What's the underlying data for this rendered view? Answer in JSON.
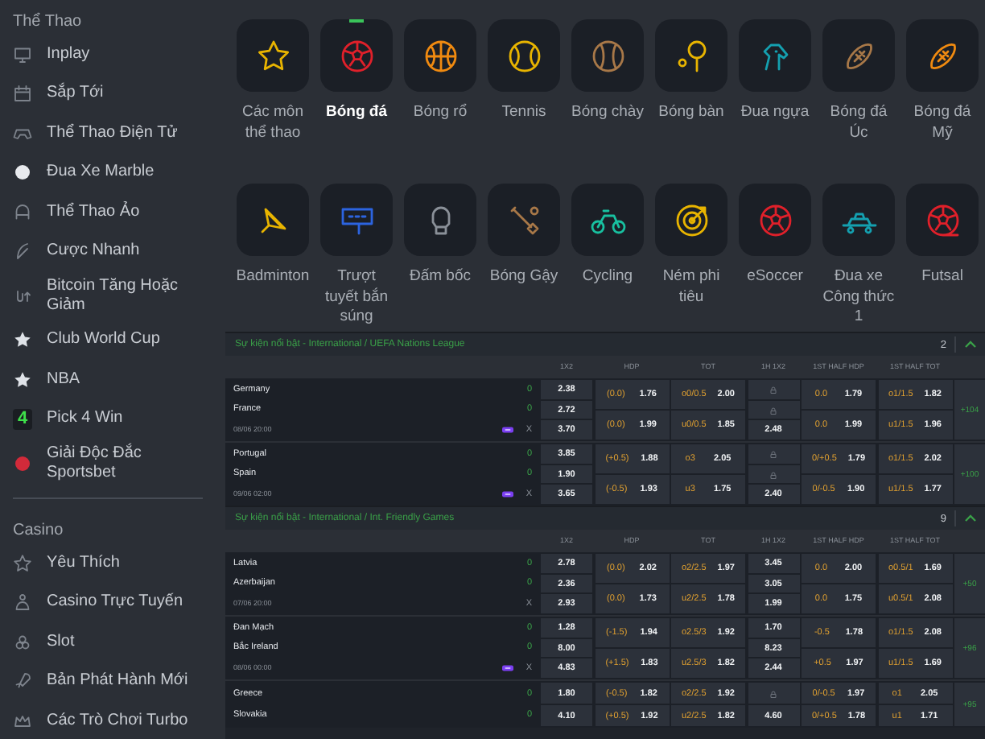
{
  "sidebar": {
    "sections": [
      {
        "heading": "Thể Thao",
        "items": [
          {
            "label": "Inplay"
          },
          {
            "label": "Sắp Tới"
          },
          {
            "label": "Thể Thao Điện Tử"
          },
          {
            "label": "Đua Xe Marble"
          },
          {
            "label": "Thể Thao Ảo"
          },
          {
            "label": "Cược Nhanh"
          },
          {
            "label": "Bitcoin Tăng Hoặc Giảm"
          },
          {
            "label": "Club World Cup"
          },
          {
            "label": "NBA"
          },
          {
            "label": "Pick 4 Win",
            "logo_text": "4"
          },
          {
            "label": "Giải Độc Đắc Sportsbet"
          }
        ]
      },
      {
        "heading": "Casino",
        "items": [
          {
            "label": "Yêu Thích"
          },
          {
            "label": "Casino Trực Tuyến"
          },
          {
            "label": "Slot"
          },
          {
            "label": "Bản Phát Hành Mới"
          },
          {
            "label": "Các Trò Chơi Turbo"
          }
        ]
      }
    ]
  },
  "sports": [
    {
      "label": "Các môn thể thao",
      "selected": false
    },
    {
      "label": "Bóng đá",
      "selected": true
    },
    {
      "label": "Bóng rổ",
      "selected": false
    },
    {
      "label": "Tennis",
      "selected": false
    },
    {
      "label": "Bóng chày",
      "selected": false
    },
    {
      "label": "Bóng bàn",
      "selected": false
    },
    {
      "label": "Đua ngựa",
      "selected": false
    },
    {
      "label": "Bóng đá Úc",
      "selected": false
    },
    {
      "label": "Bóng đá Mỹ",
      "selected": false
    },
    {
      "label": "Badminton",
      "selected": false
    },
    {
      "label": "Trượt tuyết bắn súng",
      "selected": false
    },
    {
      "label": "Đấm bốc",
      "selected": false
    },
    {
      "label": "Bóng Gậy",
      "selected": false
    },
    {
      "label": "Cycling",
      "selected": false
    },
    {
      "label": "Ném phi tiêu",
      "selected": false
    },
    {
      "label": "eSoccer",
      "selected": false
    },
    {
      "label": "Đua xe Công thức 1",
      "selected": false
    },
    {
      "label": "Futsal",
      "selected": false
    }
  ],
  "sections": [
    {
      "title": "Sự kiện nổi bật - International / UEFA Nations League",
      "count": "2",
      "expanded": true,
      "columns": [
        "1X2",
        "HDP",
        "TOT",
        "1H 1X2",
        "1ST HALF HDP",
        "1ST HALF TOT"
      ],
      "matches": [
        {
          "home": "Germany",
          "away": "France",
          "home_score": "0",
          "away_score": "0",
          "time": "08/06 20:00",
          "live": true,
          "draw": "X",
          "x12": [
            "2.38",
            "2.72",
            "3.70"
          ],
          "hdp": [
            {
              "line": "(0.0)",
              "odd": "1.76"
            },
            {
              "line": "(0.0)",
              "odd": "1.99"
            }
          ],
          "tot": [
            {
              "line": "o0/0.5",
              "odd": "2.00"
            },
            {
              "line": "u0/0.5",
              "odd": "1.85"
            }
          ],
          "h1_x12": [
            {
              "locked": true
            },
            {
              "locked": true
            },
            {
              "locked": false,
              "odd": "2.48"
            }
          ],
          "h1_hdp": [
            {
              "line": "0.0",
              "odd": "1.79"
            },
            {
              "line": "0.0",
              "odd": "1.99"
            }
          ],
          "h1_tot": [
            {
              "line": "o1/1.5",
              "odd": "1.82"
            },
            {
              "line": "u1/1.5",
              "odd": "1.96"
            }
          ],
          "more": "+104"
        },
        {
          "home": "Portugal",
          "away": "Spain",
          "home_score": "0",
          "away_score": "0",
          "time": "09/06 02:00",
          "live": true,
          "draw": "X",
          "x12": [
            "3.85",
            "1.90",
            "3.65"
          ],
          "hdp": [
            {
              "line": "(+0.5)",
              "odd": "1.88"
            },
            {
              "line": "(-0.5)",
              "odd": "1.93"
            }
          ],
          "tot": [
            {
              "line": "o3",
              "odd": "2.05"
            },
            {
              "line": "u3",
              "odd": "1.75"
            }
          ],
          "h1_x12": [
            {
              "locked": true
            },
            {
              "locked": true
            },
            {
              "locked": false,
              "odd": "2.40"
            }
          ],
          "h1_hdp": [
            {
              "line": "0/+0.5",
              "odd": "1.79"
            },
            {
              "line": "0/-0.5",
              "odd": "1.90"
            }
          ],
          "h1_tot": [
            {
              "line": "o1/1.5",
              "odd": "2.02"
            },
            {
              "line": "u1/1.5",
              "odd": "1.77"
            }
          ],
          "more": "+100"
        }
      ]
    },
    {
      "title": "Sự kiện nổi bật - International / Int. Friendly Games",
      "count": "9",
      "expanded": true,
      "columns": [
        "1X2",
        "HDP",
        "TOT",
        "1H 1X2",
        "1ST HALF HDP",
        "1ST HALF TOT"
      ],
      "matches": [
        {
          "home": "Latvia",
          "away": "Azerbaijan",
          "home_score": "0",
          "away_score": "0",
          "time": "07/06 20:00",
          "live": false,
          "draw": "X",
          "x12": [
            "2.78",
            "2.36",
            "2.93"
          ],
          "hdp": [
            {
              "line": "(0.0)",
              "odd": "2.02"
            },
            {
              "line": "(0.0)",
              "odd": "1.73"
            }
          ],
          "tot": [
            {
              "line": "o2/2.5",
              "odd": "1.97"
            },
            {
              "line": "u2/2.5",
              "odd": "1.78"
            }
          ],
          "h1_x12": [
            {
              "locked": false,
              "odd": "3.45"
            },
            {
              "locked": false,
              "odd": "3.05"
            },
            {
              "locked": false,
              "odd": "1.99"
            }
          ],
          "h1_hdp": [
            {
              "line": "0.0",
              "odd": "2.00"
            },
            {
              "line": "0.0",
              "odd": "1.75"
            }
          ],
          "h1_tot": [
            {
              "line": "o0.5/1",
              "odd": "1.69"
            },
            {
              "line": "u0.5/1",
              "odd": "2.08"
            }
          ],
          "more": "+50"
        },
        {
          "home": "Đan Mạch",
          "away": "Bắc Ireland",
          "home_score": "0",
          "away_score": "0",
          "time": "08/06 00:00",
          "live": true,
          "draw": "X",
          "x12": [
            "1.28",
            "8.00",
            "4.83"
          ],
          "hdp": [
            {
              "line": "(-1.5)",
              "odd": "1.94"
            },
            {
              "line": "(+1.5)",
              "odd": "1.83"
            }
          ],
          "tot": [
            {
              "line": "o2.5/3",
              "odd": "1.92"
            },
            {
              "line": "u2.5/3",
              "odd": "1.82"
            }
          ],
          "h1_x12": [
            {
              "locked": false,
              "odd": "1.70"
            },
            {
              "locked": false,
              "odd": "8.23"
            },
            {
              "locked": false,
              "odd": "2.44"
            }
          ],
          "h1_hdp": [
            {
              "line": "-0.5",
              "odd": "1.78"
            },
            {
              "line": "+0.5",
              "odd": "1.97"
            }
          ],
          "h1_tot": [
            {
              "line": "o1/1.5",
              "odd": "2.08"
            },
            {
              "line": "u1/1.5",
              "odd": "1.69"
            }
          ],
          "more": "+96"
        },
        {
          "home": "Greece",
          "away": "Slovakia",
          "home_score": "0",
          "away_score": "0",
          "x12": [
            "1.80",
            "4.10"
          ],
          "hdp": [
            {
              "line": "(-0.5)",
              "odd": "1.82"
            },
            {
              "line": "(+0.5)",
              "odd": "1.92"
            }
          ],
          "tot": [
            {
              "line": "o2/2.5",
              "odd": "1.92"
            },
            {
              "line": "u2/2.5",
              "odd": "1.82"
            }
          ],
          "h1_x12": [
            {
              "locked": true
            },
            {
              "locked": false,
              "odd": "4.60"
            }
          ],
          "h1_hdp": [
            {
              "line": "0/-0.5",
              "odd": "1.97"
            },
            {
              "line": "0/+0.5",
              "odd": "1.78"
            }
          ],
          "h1_tot": [
            {
              "line": "o1",
              "odd": "2.05"
            },
            {
              "line": "u1",
              "odd": "1.71"
            }
          ],
          "more": "+95"
        }
      ]
    }
  ]
}
